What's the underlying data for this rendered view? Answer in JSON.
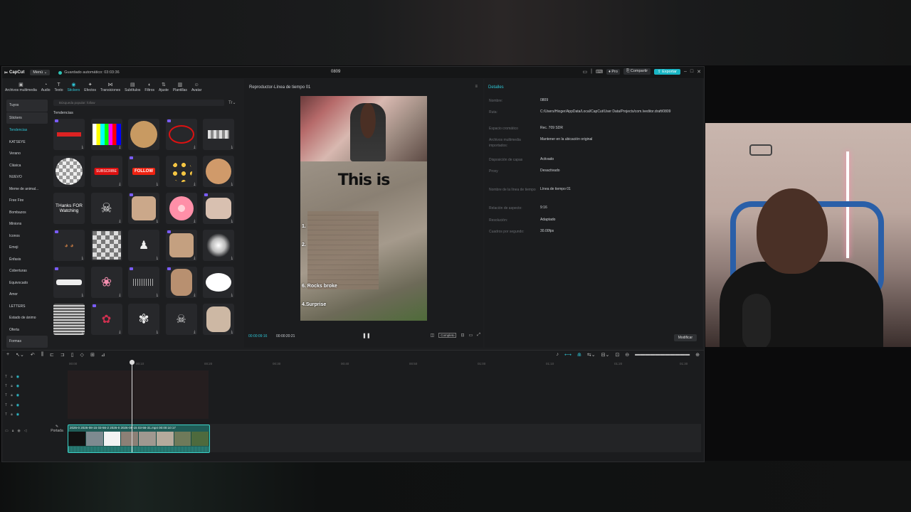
{
  "titlebar": {
    "app_name": "CapCut",
    "menu_label": "Menú",
    "autosave": "Guardado automático: 03:03:36",
    "project_title": "0809",
    "pro_label": "Pro",
    "share_label": "Compartir",
    "export_label": "Exportar"
  },
  "toolbar": [
    {
      "label": "Archivos multimedia",
      "icon": "media-icon"
    },
    {
      "label": "Audio",
      "icon": "audio-icon"
    },
    {
      "label": "Texto",
      "icon": "text-icon"
    },
    {
      "label": "Stickers",
      "icon": "sticker-icon"
    },
    {
      "label": "Efectos",
      "icon": "effects-icon"
    },
    {
      "label": "Transiciones",
      "icon": "transition-icon"
    },
    {
      "label": "Subtítulos",
      "icon": "subtitle-icon"
    },
    {
      "label": "Filtros",
      "icon": "filter-icon"
    },
    {
      "label": "Ajuste",
      "icon": "adjust-icon"
    },
    {
      "label": "Plantillas",
      "icon": "template-icon"
    },
    {
      "label": "Avatar",
      "icon": "avatar-icon"
    }
  ],
  "categories": {
    "tuyos": "Tuyos",
    "stickers": "Stickers",
    "items": [
      "Tendencias",
      "KATSEYE",
      "Verano",
      "Clásica",
      "NUEVO",
      "Meme de animal...",
      "Free Fire",
      "Bombazos",
      "Minions",
      "Iconos",
      "Emoji",
      "Énfasis",
      "Coberturas",
      "Equivocado",
      "Amor",
      "LETTERS",
      "Estado de ánimo",
      "Oferta",
      "Formas"
    ]
  },
  "search": {
    "placeholder": "Búsqueda popular: follow"
  },
  "section_title": "Tendencias",
  "stickers": {
    "subscribe": "SUBSCRIBE",
    "follow": "FOLLOW",
    "thanks": "THanks FOR Watching"
  },
  "player": {
    "title": "Reproductor-Línea de tiempo 01",
    "video_text": "This is",
    "label_1": "1.",
    "label_2": "2.",
    "label_6": "6. Rocks broke",
    "label_4": "4.Surprise",
    "current_time": "00:00:09:16",
    "duration": "00:00:20:21",
    "ratio_button": "Completo"
  },
  "details": {
    "title": "Detalles",
    "rows": [
      {
        "label": "Nombre:",
        "value": "0809"
      },
      {
        "label": "Ruta:",
        "value": "C:/Users/Hioger/AppData/Local/CapCut/User Data/Projects/com.lveditor.draft/0809"
      },
      {
        "label": "Espacio cromático",
        "value": "Rec. 709 SDR"
      },
      {
        "label": "Archivos multimedia importados:",
        "value": "Mantener en la ubicación original"
      },
      {
        "label": "Disposición de capas",
        "value": "Activado"
      },
      {
        "label": "Proxy",
        "value": "Desactivado"
      },
      {
        "label": "Nombre de la línea de tiempo",
        "value": "Línea de tiempo 01"
      },
      {
        "label": "Relación de aspecto:",
        "value": "9:16"
      },
      {
        "label": "Resolución:",
        "value": "Adaptado"
      },
      {
        "label": "Cuadros por segundo:",
        "value": "30.00fps"
      }
    ],
    "modify_label": "Modificar"
  },
  "timeline": {
    "ruler": [
      "00:00",
      "00:10",
      "00:20",
      "00:30",
      "00:40",
      "00:50",
      "01:00",
      "01:10",
      "01:20",
      "01:30"
    ],
    "cover_label": "Portada",
    "clip_label": "2026-0 2026-08-15 03-56-2 2026-0 2026-08-15 03-56-31.mp4 00:00:10:17"
  },
  "colors": {
    "accent": "#2ec4d4",
    "export": "#19b5c4",
    "clip": "#1f5c57"
  }
}
